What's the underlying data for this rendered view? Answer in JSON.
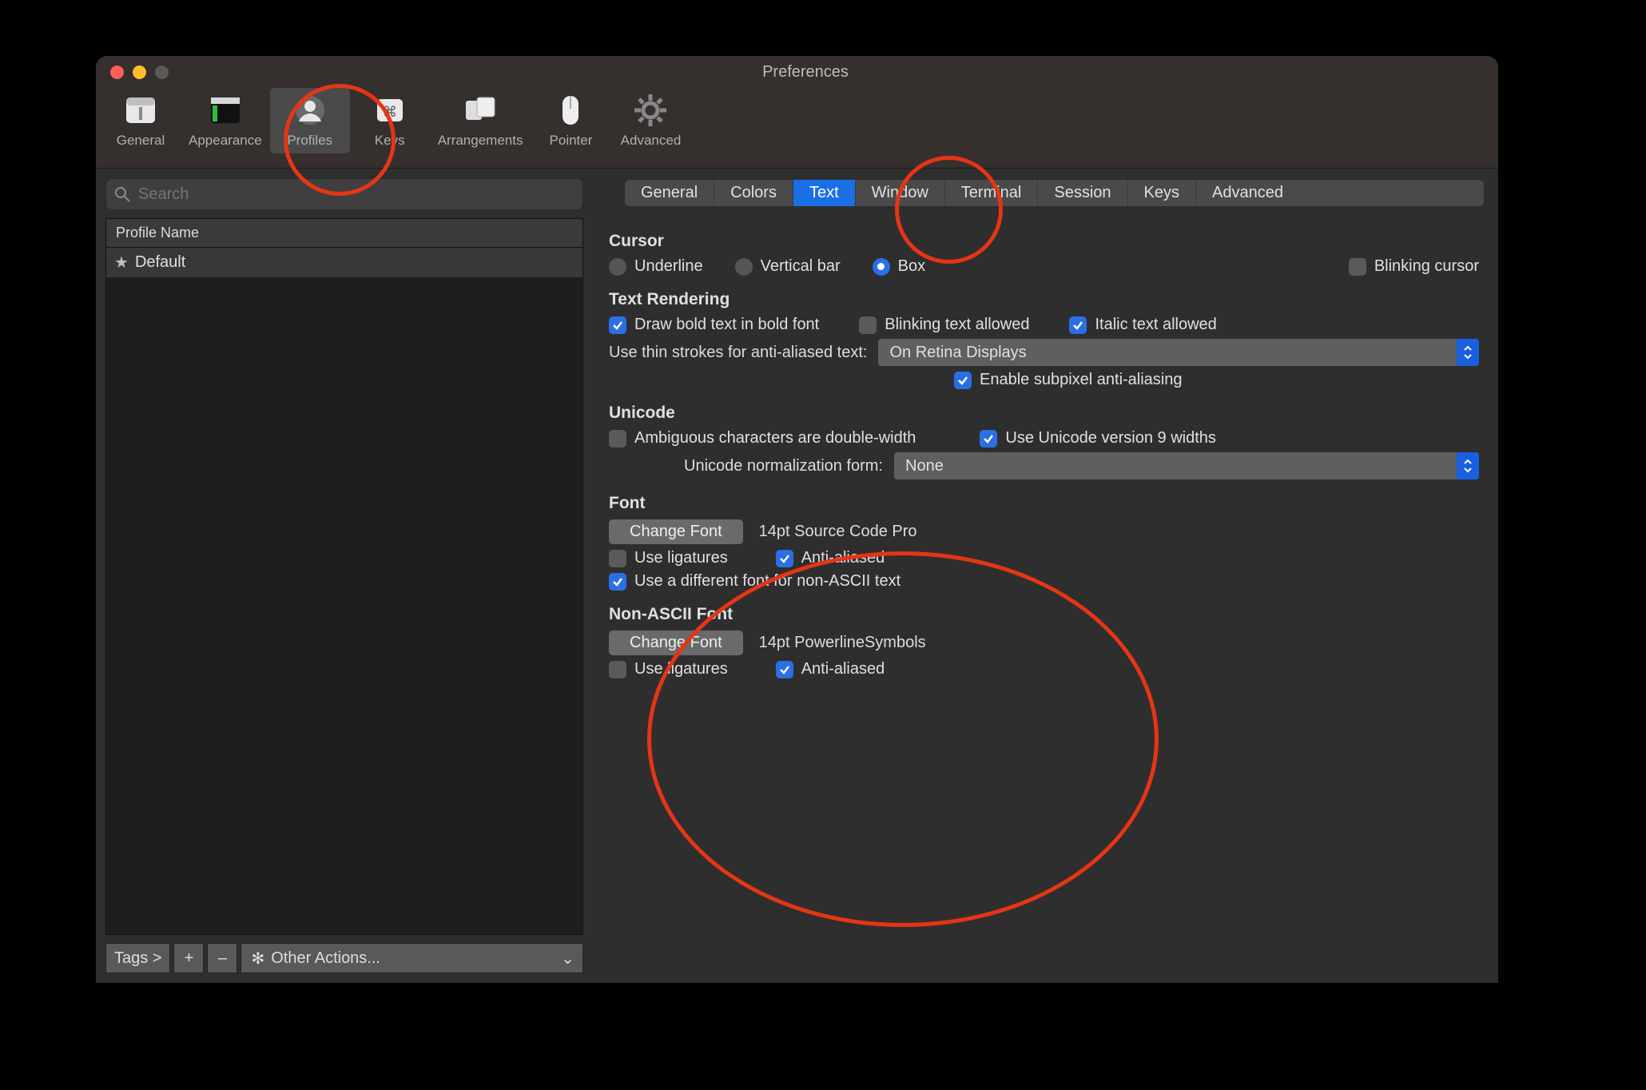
{
  "window": {
    "title": "Preferences"
  },
  "toolbar": {
    "items": [
      {
        "label": "General"
      },
      {
        "label": "Appearance"
      },
      {
        "label": "Profiles"
      },
      {
        "label": "Keys"
      },
      {
        "label": "Arrangements"
      },
      {
        "label": "Pointer"
      },
      {
        "label": "Advanced"
      }
    ],
    "active": "Profiles"
  },
  "sidebar": {
    "search_placeholder": "Search",
    "column_header": "Profile Name",
    "profiles": [
      {
        "name": "Default",
        "is_default": true
      }
    ],
    "bottom": {
      "tags_label": "Tags >",
      "plus": "+",
      "minus": "–",
      "other_actions": "Other Actions..."
    }
  },
  "profile_tabs": {
    "items": [
      "General",
      "Colors",
      "Text",
      "Window",
      "Terminal",
      "Session",
      "Keys",
      "Advanced"
    ],
    "active": "Text"
  },
  "cursor": {
    "title": "Cursor",
    "options": {
      "underline": "Underline",
      "vertical": "Vertical bar",
      "box": "Box"
    },
    "selected": "box",
    "blinking": {
      "label": "Blinking cursor",
      "checked": false
    }
  },
  "text_rendering": {
    "title": "Text Rendering",
    "bold": {
      "label": "Draw bold text in bold font",
      "checked": true
    },
    "blinking_text": {
      "label": "Blinking text allowed",
      "checked": false
    },
    "italic": {
      "label": "Italic text allowed",
      "checked": true
    },
    "thin_strokes_label": "Use thin strokes for anti-aliased text:",
    "thin_strokes_value": "On Retina Displays",
    "subpixel": {
      "label": "Enable subpixel anti-aliasing",
      "checked": true
    }
  },
  "unicode": {
    "title": "Unicode",
    "ambiguous": {
      "label": "Ambiguous characters are double-width",
      "checked": false
    },
    "v9": {
      "label": "Use Unicode version 9 widths",
      "checked": true
    },
    "norm_label": "Unicode normalization form:",
    "norm_value": "None"
  },
  "font": {
    "title": "Font",
    "change_btn": "Change Font",
    "current": "14pt Source Code Pro",
    "ligatures": {
      "label": "Use ligatures",
      "checked": false
    },
    "aa": {
      "label": "Anti-aliased",
      "checked": true
    },
    "diff_font": {
      "label": "Use a different font for non-ASCII text",
      "checked": true
    }
  },
  "nonascii": {
    "title": "Non-ASCII Font",
    "change_btn": "Change Font",
    "current": "14pt PowerlineSymbols",
    "ligatures": {
      "label": "Use ligatures",
      "checked": false
    },
    "aa": {
      "label": "Anti-aliased",
      "checked": true
    }
  }
}
